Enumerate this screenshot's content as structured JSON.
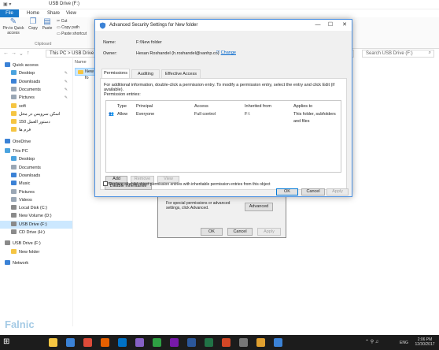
{
  "explorer": {
    "title": "USB Drive (F:)",
    "ribbon_tabs": [
      "File",
      "Home",
      "Share",
      "View"
    ],
    "ribbon": {
      "pin_label": "Pin to Quick access",
      "copy_label": "Copy",
      "paste_label": "Paste",
      "cut_label": "Cut",
      "copy_path_label": "Copy path",
      "paste_shortcut_label": "Paste shortcut",
      "clipboard_group": "Clipboard"
    },
    "address": "This PC  >  USB Drive (F:)",
    "search_placeholder": "Search USB Drive (F:)",
    "column_header": "Name",
    "file_item": "New fo",
    "nav_items": [
      {
        "label": "Quick access",
        "icon": "star-icon",
        "color": "#3b82d6"
      },
      {
        "label": "Desktop",
        "icon": "desktop-icon",
        "color": "#4aa3df"
      },
      {
        "label": "Downloads",
        "icon": "download-icon",
        "color": "#3b82d6"
      },
      {
        "label": "Documents",
        "icon": "documents-icon",
        "color": "#9aa7b5"
      },
      {
        "label": "Pictures",
        "icon": "pictures-icon",
        "color": "#9aa7b5"
      },
      {
        "label": "soft",
        "icon": "folder-icon",
        "color": "#f5c542"
      },
      {
        "label": "اسکن سرویس در محل",
        "icon": "folder-icon",
        "color": "#f5c542"
      },
      {
        "label": "150 دستور العمل",
        "icon": "folder-icon",
        "color": "#f5c542"
      },
      {
        "label": "فرم ها",
        "icon": "folder-icon",
        "color": "#f5c542"
      },
      {
        "label": "OneDrive",
        "icon": "cloud-icon",
        "color": "#3b82d6"
      },
      {
        "label": "This PC",
        "icon": "computer-icon",
        "color": "#4aa3df"
      },
      {
        "label": "Desktop",
        "icon": "desktop-icon",
        "color": "#4aa3df"
      },
      {
        "label": "Documents",
        "icon": "documents-icon",
        "color": "#9aa7b5"
      },
      {
        "label": "Downloads",
        "icon": "download-icon",
        "color": "#3b82d6"
      },
      {
        "label": "Music",
        "icon": "music-icon",
        "color": "#3b82d6"
      },
      {
        "label": "Pictures",
        "icon": "pictures-icon",
        "color": "#9aa7b5"
      },
      {
        "label": "Videos",
        "icon": "videos-icon",
        "color": "#9aa7b5"
      },
      {
        "label": "Local Disk (C:)",
        "icon": "disk-icon",
        "color": "#8a8a8a"
      },
      {
        "label": "New Volume (D:)",
        "icon": "disk-icon",
        "color": "#8a8a8a"
      },
      {
        "label": "USB Drive (F:)",
        "icon": "usb-drive-icon",
        "color": "#8a8a8a"
      },
      {
        "label": "CD Drive (H:)",
        "icon": "cd-drive-icon",
        "color": "#8a8a8a"
      },
      {
        "label": "USB Drive (F:)",
        "icon": "usb-drive-icon",
        "color": "#8a8a8a"
      },
      {
        "label": "New folder",
        "icon": "folder-icon",
        "color": "#f5c542"
      },
      {
        "label": "Network",
        "icon": "network-icon",
        "color": "#3b82d6"
      }
    ]
  },
  "properties_dialog": {
    "text": "For special permissions or advanced settings, click Advanced.",
    "advanced_button": "Advanced",
    "ok": "OK",
    "cancel": "Cancel",
    "apply": "Apply"
  },
  "adv_dialog": {
    "title": "Advanced Security Settings for New folder",
    "name_label": "Name:",
    "name_value": "F:\\New folder",
    "owner_label": "Owner:",
    "owner_value": "Hesan Roshandel (h.roshandel@vanhp.co)",
    "change_link": "Change",
    "tabs": [
      "Permissions",
      "Auditing",
      "Effective Access"
    ],
    "info": "For additional information, double-click a permission entry. To modify a permission entry, select the entry and click Edit (if available).",
    "entries_label": "Permission entries:",
    "columns": [
      "Type",
      "Principal",
      "Access",
      "Inherited from",
      "Applies to"
    ],
    "rows": [
      {
        "type": "Allow",
        "principal": "Everyone",
        "access": "Full control",
        "inherited": "F:\\",
        "applies": "This folder, subfolders and files"
      }
    ],
    "add": "Add",
    "remove": "Remove",
    "view": "View",
    "disable_inheritance": "Disable inheritance",
    "replace_label": "Replace all child object permission entries with inheritable permission entries from this object",
    "ok": "OK",
    "cancel": "Cancel",
    "apply": "Apply",
    "accent": "#0078d7"
  },
  "taskbar": {
    "icons": [
      {
        "name": "explorer-icon",
        "color": "#f5c542"
      },
      {
        "name": "store-icon",
        "color": "#3b82d6"
      },
      {
        "name": "chrome-icon",
        "color": "#dd4b39"
      },
      {
        "name": "firefox-icon",
        "color": "#e66000"
      },
      {
        "name": "outlook-icon",
        "color": "#0072c6"
      },
      {
        "name": "visual-studio-icon",
        "color": "#8661c5"
      },
      {
        "name": "app-icon",
        "color": "#2ea043"
      },
      {
        "name": "onenote-icon",
        "color": "#7719aa"
      },
      {
        "name": "word-icon",
        "color": "#2b579a"
      },
      {
        "name": "excel-icon",
        "color": "#217346"
      },
      {
        "name": "powerpoint-icon",
        "color": "#d24726"
      },
      {
        "name": "settings-icon",
        "color": "#777777"
      },
      {
        "name": "media-icon",
        "color": "#e0a030"
      },
      {
        "name": "app-icon",
        "color": "#3b82d6"
      }
    ],
    "lang": "ENG",
    "time": "2:06 PM",
    "date": "12/30/2017"
  },
  "watermark": "Falnic"
}
